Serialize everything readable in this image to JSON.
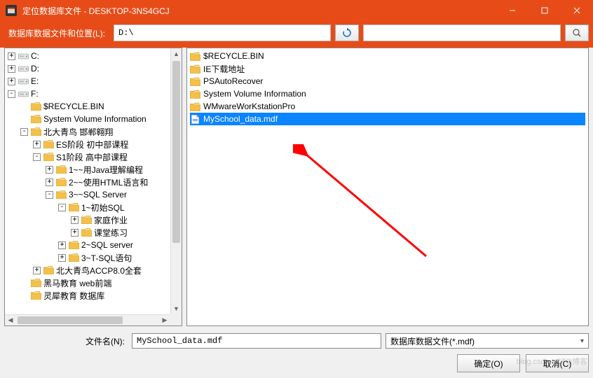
{
  "window": {
    "title": "定位数据库文件 - DESKTOP-3NS4GCJ"
  },
  "toolbar": {
    "location_label": "数据库数据文件和位置(L):",
    "path_value": "D:\\",
    "search_value": ""
  },
  "tree": [
    {
      "depth": 0,
      "expander": "+",
      "icon": "drive",
      "label": "C:"
    },
    {
      "depth": 0,
      "expander": "+",
      "icon": "drive",
      "label": "D:"
    },
    {
      "depth": 0,
      "expander": "+",
      "icon": "drive",
      "label": "E:"
    },
    {
      "depth": 0,
      "expander": "-",
      "icon": "drive",
      "label": "F:"
    },
    {
      "depth": 1,
      "expander": "",
      "icon": "folder",
      "label": "$RECYCLE.BIN"
    },
    {
      "depth": 1,
      "expander": "",
      "icon": "folder",
      "label": "System Volume Information"
    },
    {
      "depth": 1,
      "expander": "-",
      "icon": "folder",
      "label": "北大青鸟 邯郸翱翔"
    },
    {
      "depth": 2,
      "expander": "+",
      "icon": "folder",
      "label": "ES阶段 初中部课程"
    },
    {
      "depth": 2,
      "expander": "-",
      "icon": "folder",
      "label": "S1阶段 高中部课程"
    },
    {
      "depth": 3,
      "expander": "+",
      "icon": "folder",
      "label": "1~~用Java理解编程"
    },
    {
      "depth": 3,
      "expander": "+",
      "icon": "folder",
      "label": "2~~使用HTML语言和"
    },
    {
      "depth": 3,
      "expander": "-",
      "icon": "folder",
      "label": "3~~SQL Server"
    },
    {
      "depth": 4,
      "expander": "-",
      "icon": "folder",
      "label": "1~初始SQL"
    },
    {
      "depth": 5,
      "expander": "+",
      "icon": "folder",
      "label": "家庭作业"
    },
    {
      "depth": 5,
      "expander": "+",
      "icon": "folder",
      "label": "课堂练习"
    },
    {
      "depth": 4,
      "expander": "+",
      "icon": "folder",
      "label": "2~SQL server"
    },
    {
      "depth": 4,
      "expander": "+",
      "icon": "folder",
      "label": "3~T-SQL语句"
    },
    {
      "depth": 2,
      "expander": "+",
      "icon": "folder",
      "label": "北大青鸟ACCP8.0全套"
    },
    {
      "depth": 1,
      "expander": "",
      "icon": "folder",
      "label": "黑马教育 web前端"
    },
    {
      "depth": 1,
      "expander": "",
      "icon": "folder",
      "label": "灵犀教育  数据库"
    }
  ],
  "list": [
    {
      "icon": "folder",
      "label": "$RECYCLE.BIN",
      "selected": false
    },
    {
      "icon": "folder",
      "label": "IE下载地址",
      "selected": false
    },
    {
      "icon": "folder",
      "label": "PSAutoRecover",
      "selected": false
    },
    {
      "icon": "folder",
      "label": "System Volume Information",
      "selected": false
    },
    {
      "icon": "folder",
      "label": "WMwareWorKstationPro",
      "selected": false
    },
    {
      "icon": "file",
      "label": "MySchool_data.mdf",
      "selected": true
    }
  ],
  "bottom": {
    "filename_label": "文件名(N):",
    "filename_value": "MySchool_data.mdf",
    "filetype_value": "数据库数据文件(*.mdf)",
    "ok_label": "确定(O)",
    "cancel_label": "取消(C)"
  },
  "watermark": "blog.csdn.nCTO博客"
}
